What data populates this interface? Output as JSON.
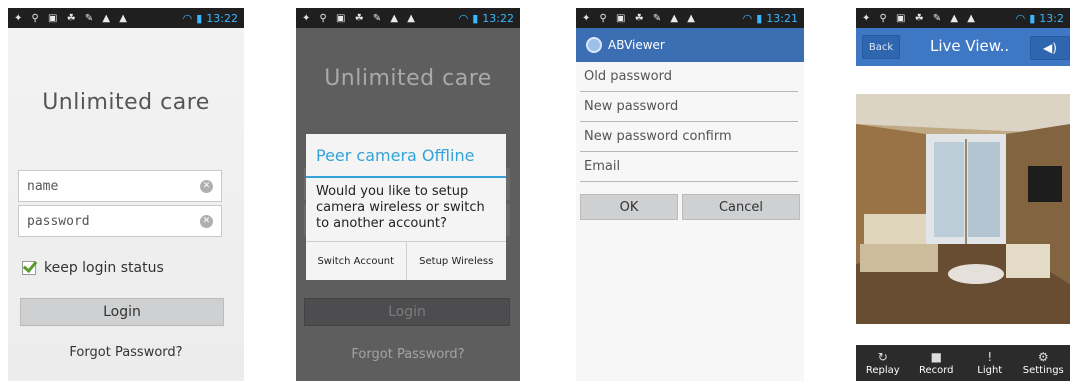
{
  "status": {
    "s1_time": "13:22",
    "s2_time": "13:22",
    "s3_time": "13:21",
    "s4_time": "13:2",
    "icons": "✦ ⚲ ▣ ☘ ✎ ▲ ▲"
  },
  "screen1": {
    "title": "Unlimited care",
    "name_placeholder": "name",
    "password_placeholder": "password",
    "keep_login": "keep login status",
    "login": "Login",
    "forgot": "Forgot Password?"
  },
  "screen2": {
    "title": "Unlimited care",
    "dialog_title": "Peer camera Offline",
    "dialog_message": "Would you like to setup camera wireless or switch to another account?",
    "switch_account": "Switch Account",
    "setup_wireless": "Setup Wireless",
    "login": "Login",
    "forgot": "Forgot Password?"
  },
  "screen3": {
    "app_name": "ABViewer",
    "old_password": "Old password",
    "new_password": "New password",
    "new_password_confirm": "New password confirm",
    "email": "Email",
    "ok": "OK",
    "cancel": "Cancel"
  },
  "screen4": {
    "back": "Back",
    "title": "Live View..",
    "volume_icon": "speaker-icon",
    "tools": [
      {
        "icon": "replay-icon",
        "label": "Replay"
      },
      {
        "icon": "record-icon",
        "label": "Record"
      },
      {
        "icon": "light-icon",
        "label": "Light"
      },
      {
        "icon": "settings-icon",
        "label": "Settings"
      }
    ]
  },
  "colors": {
    "accent_blue": "#33a3d8",
    "actionbar_blue": "#3c6eb4",
    "liveview_blue": "#3e78c4",
    "checkbox_green": "#5a9c2c"
  }
}
